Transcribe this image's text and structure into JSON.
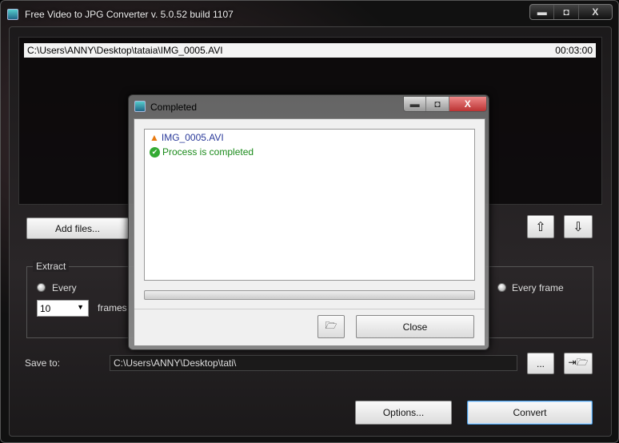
{
  "window": {
    "title": "Free Video to JPG Converter  v. 5.0.52 build 1107",
    "controls": {
      "minimize": "▬",
      "maximize": "◘",
      "close": "X"
    }
  },
  "files": [
    {
      "path": "C:\\Users\\ANNY\\Desktop\\tataia\\IMG_0005.AVI",
      "duration": "00:03:00"
    }
  ],
  "buttons": {
    "add_files": "Add files...",
    "up": "⇧",
    "down": "⇩",
    "browse": "...",
    "open_folder": "open-folder-icon",
    "options": "Options...",
    "convert": "Convert"
  },
  "extract": {
    "legend": "Extract",
    "every_label": "Every",
    "every_value": "10",
    "frames_label": "frames",
    "every_frame_label": "Every frame"
  },
  "save": {
    "label": "Save to:",
    "path": "C:\\Users\\ANNY\\Desktop\\tati\\"
  },
  "dialog": {
    "title": "Completed",
    "file": "IMG_0005.AVI",
    "status": "Process is completed",
    "progress": 1.0,
    "close": "Close",
    "controls": {
      "minimize": "▬",
      "maximize": "◘",
      "close": "X"
    }
  },
  "colors": {
    "file_text": "#2a3a9a",
    "status_text": "#1a8a1a",
    "accent_border": "#4a9be0"
  }
}
